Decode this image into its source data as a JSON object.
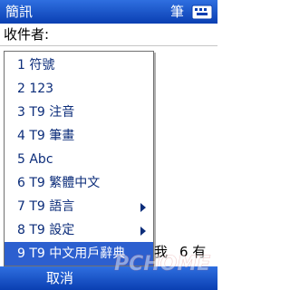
{
  "titlebar": {
    "title": "簡訊",
    "input_mode": "筆"
  },
  "recipient": {
    "label": "收件者:",
    "value": ""
  },
  "menu": {
    "items": [
      {
        "label": "1 符號",
        "has_submenu": false,
        "selected": false
      },
      {
        "label": "2 123",
        "has_submenu": false,
        "selected": false
      },
      {
        "label": "3 T9 注音",
        "has_submenu": false,
        "selected": false
      },
      {
        "label": "4 T9 筆畫",
        "has_submenu": false,
        "selected": false
      },
      {
        "label": "5 Abc",
        "has_submenu": false,
        "selected": false
      },
      {
        "label": "6 T9 繁體中文",
        "has_submenu": false,
        "selected": false
      },
      {
        "label": "7 T9 語言",
        "has_submenu": true,
        "selected": false
      },
      {
        "label": "8 T9 設定",
        "has_submenu": true,
        "selected": false
      },
      {
        "label": "9 T9 中文用戶辭典",
        "has_submenu": false,
        "selected": true
      }
    ]
  },
  "candidate_bar": {
    "char_1": "我",
    "char_2": "6 有"
  },
  "softkeys": {
    "left": "取消"
  },
  "icons": {
    "keyboard": "keyboard-icon",
    "submenu": "chevron-right-icon"
  },
  "colors": {
    "title_bar": "#1a52cc",
    "selection": "#2c5fcf",
    "menu_text": "#0c2d7a"
  },
  "watermark_text": "PCHOME"
}
